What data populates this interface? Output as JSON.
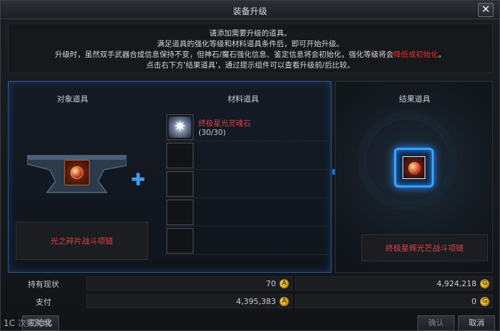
{
  "window": {
    "title": "装备升级"
  },
  "notice": {
    "line1": "请添加需要升级的道具。",
    "line2": "满足道具的强化等级和材料道具条件后，即可开始升级。",
    "line3_pre": "升级时，虽然双手武器合成信息保持不变，但神石/魔石强化信息、鉴定信息将会初始化，强化等级将会",
    "line3_warn": "降低或初始化",
    "line3_post": "。",
    "line4": "点击右下方'结果道具'，通过提示组件可以查看升级前/后比较。"
  },
  "target": {
    "header": "对象道具",
    "item_name": "光之碎片战斗项链"
  },
  "materials": {
    "header": "材料道具",
    "items": [
      {
        "name": "终极星光灵魂石",
        "count": "(30/30)"
      }
    ]
  },
  "result": {
    "header": "结果道具",
    "item_name": "终极星辉光芒战斗项链"
  },
  "stats": {
    "holding_label": "持有现状",
    "holding_left": "70",
    "holding_right": "4,924,218",
    "pay_label": "支付",
    "pay_left": "4,395,383",
    "pay_right": "0"
  },
  "buttons": {
    "reset": "初始化",
    "confirm": "确认",
    "cancel": "取消"
  },
  "watermark": {
    "mark": "1C",
    "text": "次数跨境"
  },
  "colors": {
    "accent": "#2a8dff",
    "warning": "#e0332f",
    "item_name": "#e0404a"
  },
  "icons": [
    "close-icon",
    "plus-icon",
    "arrow-right-icon",
    "gold-coin-icon",
    "anvil-icon",
    "necklace-icon",
    "soul-stone-icon"
  ]
}
